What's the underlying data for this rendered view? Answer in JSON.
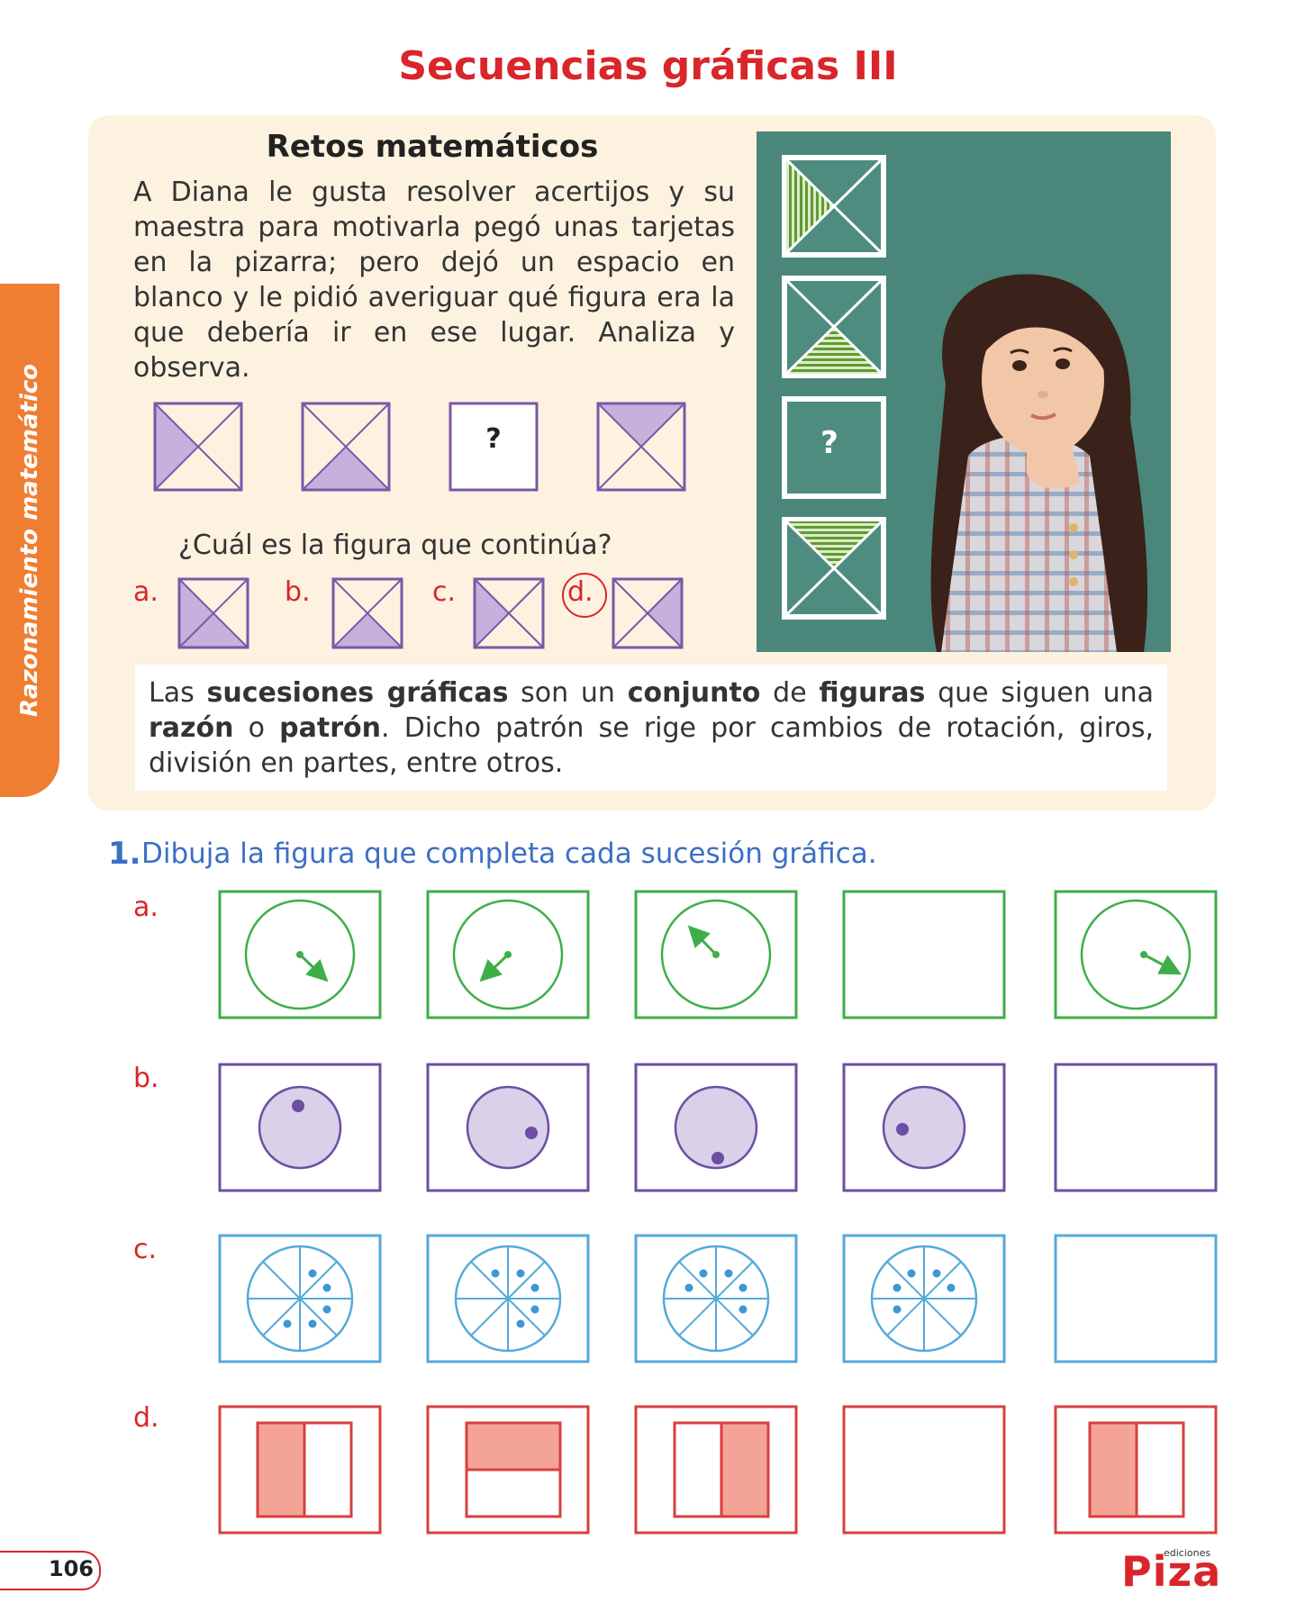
{
  "page": {
    "title": "Secuencias gráficas III",
    "side_tab": "Razonamiento matemático",
    "page_number": "106",
    "publisher_small": "ediciones",
    "publisher": "Piza"
  },
  "retos": {
    "heading": "Retos matemáticos",
    "intro": "A Diana le gusta resolver acertijos y su maestra para motivarla pegó unas tarjetas en la pizarra; pero dejó un espacio en blanco y le pidió averiguar qué figura era la que debería ir en ese lugar. Analiza y observa.",
    "question_mark": "?",
    "question": "¿Cuál es la figura que continúa?",
    "options": [
      "a.",
      "b.",
      "c.",
      "d."
    ],
    "circled_option": "d.",
    "photo_question_mark": "?"
  },
  "definition": {
    "parts": [
      {
        "text": "Las ",
        "bold": false
      },
      {
        "text": "sucesiones gráficas",
        "bold": true
      },
      {
        "text": " son un ",
        "bold": false
      },
      {
        "text": "conjunto",
        "bold": true
      },
      {
        "text": " de ",
        "bold": false
      },
      {
        "text": "figuras",
        "bold": true
      },
      {
        "text": " que siguen una ",
        "bold": false
      },
      {
        "text": "razón",
        "bold": true
      },
      {
        "text": " o ",
        "bold": false
      },
      {
        "text": "patrón",
        "bold": true
      },
      {
        "text": ". Dicho patrón se rige por cambios de rotación, giros, división en partes, entre otros.",
        "bold": false
      }
    ]
  },
  "exercise": {
    "number": "1.",
    "instruction": "Dibuja la figura que completa cada sucesión gráfica.",
    "rows": [
      {
        "label": "a.",
        "color": "#3fae49",
        "blank_index": 3
      },
      {
        "label": "b.",
        "color": "#6c4fa3",
        "blank_index": 4
      },
      {
        "label": "c.",
        "color": "#57a9db",
        "blank_index": 4
      },
      {
        "label": "d.",
        "color": "#d8403e",
        "blank_index": 3
      }
    ]
  },
  "colors": {
    "title_red": "#d8262b",
    "purple": "#7b58a8",
    "purple_fill": "#c6b1dd",
    "green": "#3fae49",
    "blue": "#57a9db",
    "red": "#d8403e",
    "salmon": "#f4a496",
    "chalkboard": "#4f8c80"
  },
  "icons": [
    "girl-thinking-photo",
    "chalkboard-card-icon",
    "arrow-icon",
    "dot-icon"
  ]
}
